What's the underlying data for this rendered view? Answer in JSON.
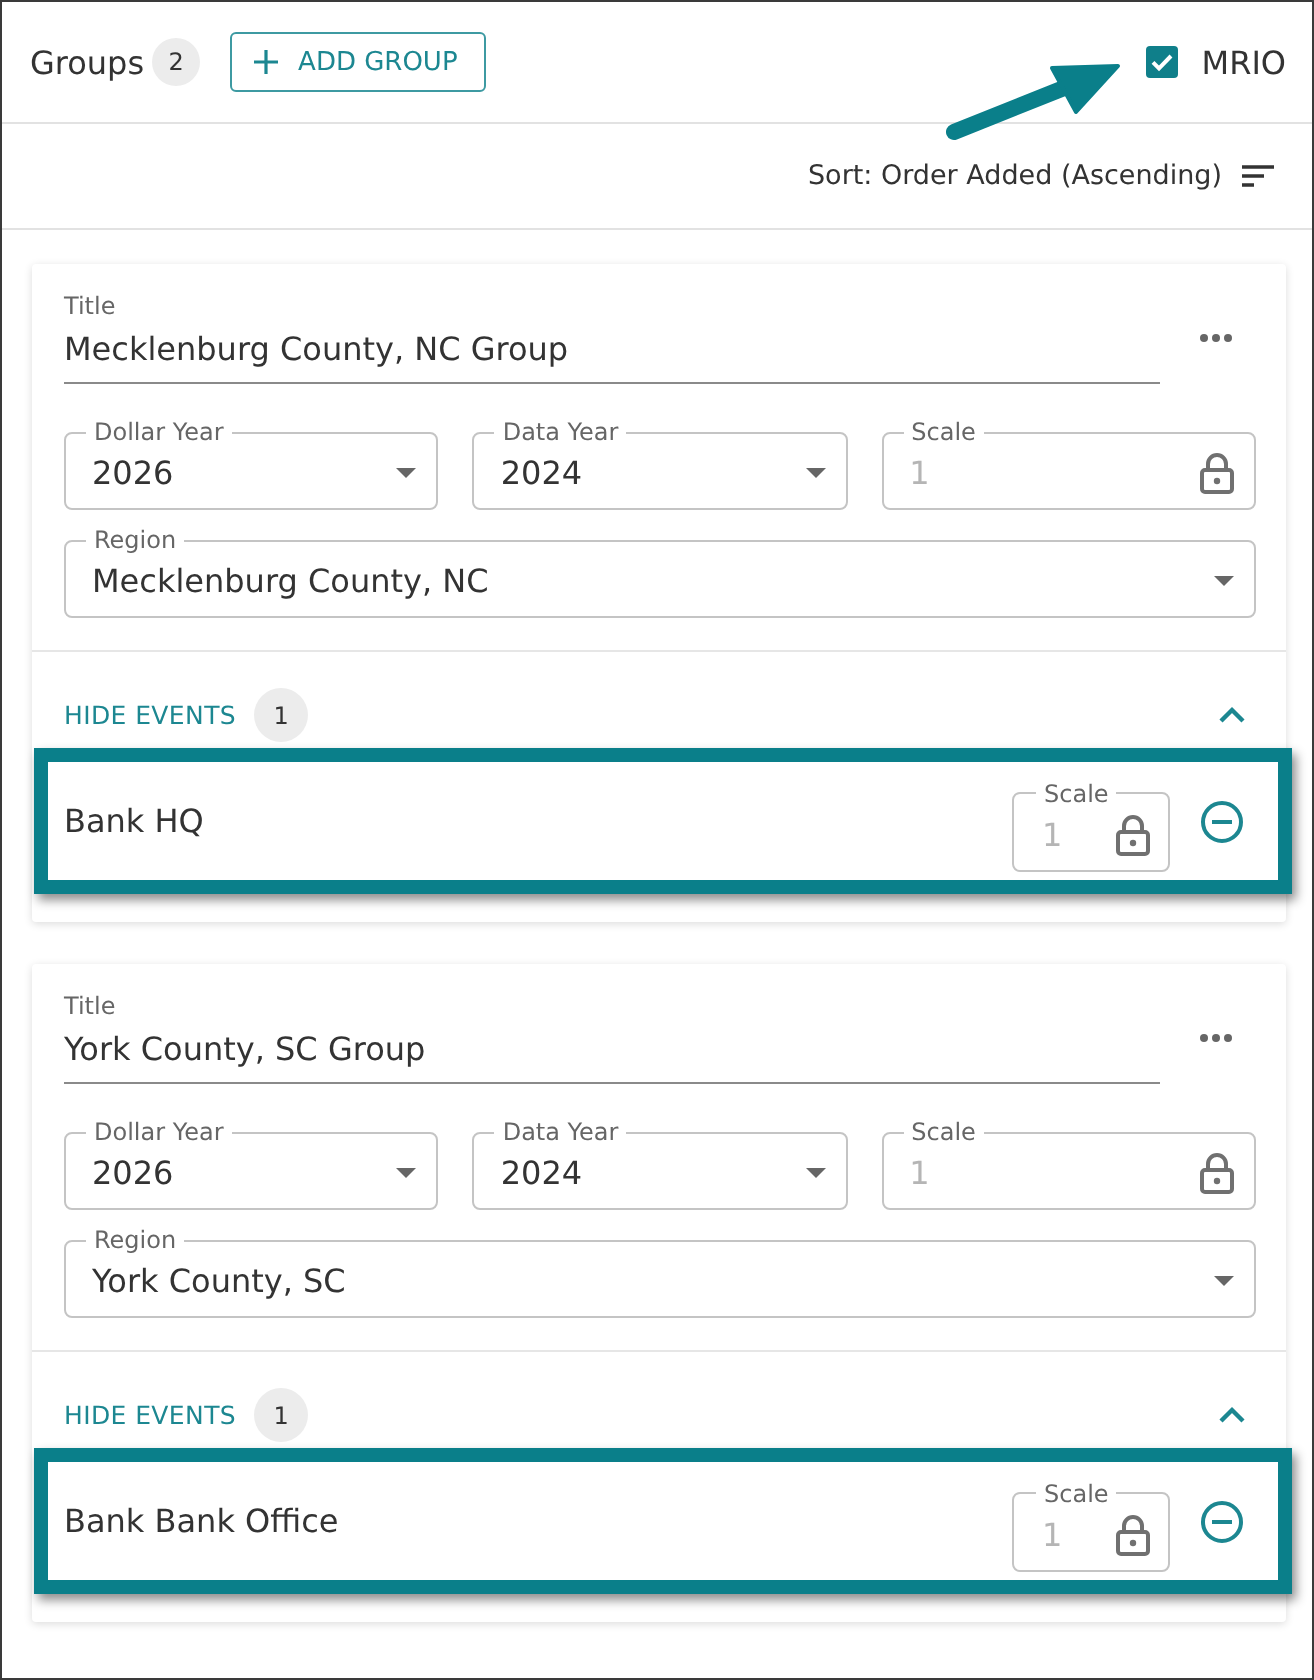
{
  "header": {
    "title": "Groups",
    "count": "2",
    "add_button": "ADD GROUP",
    "mrio": {
      "label": "MRIO",
      "checked": true,
      "arrow": true
    }
  },
  "sort": {
    "label": "Sort: Order Added (Ascending)"
  },
  "groups": [
    {
      "title_label": "Title",
      "title": "Mecklenburg County, NC Group",
      "fields": [
        {
          "kind": "select",
          "label": "Dollar Year",
          "value": "2026"
        },
        {
          "kind": "select",
          "label": "Data Year",
          "value": "2024"
        },
        {
          "kind": "locked",
          "label": "Scale",
          "value": "1"
        }
      ],
      "region": {
        "kind": "select",
        "label": "Region",
        "value": "Mecklenburg County, NC"
      },
      "events_toggle": {
        "label": "HIDE EVENTS",
        "count": "1",
        "expanded": true
      },
      "events": [
        {
          "name": "Bank HQ",
          "highlighted": true,
          "scale": {
            "kind": "locked",
            "label": "Scale",
            "value": "1"
          }
        }
      ]
    },
    {
      "title_label": "Title",
      "title": "York County, SC Group",
      "fields": [
        {
          "kind": "select",
          "label": "Dollar Year",
          "value": "2026"
        },
        {
          "kind": "select",
          "label": "Data Year",
          "value": "2024"
        },
        {
          "kind": "locked",
          "label": "Scale",
          "value": "1"
        }
      ],
      "region": {
        "kind": "select",
        "label": "Region",
        "value": "York County, SC"
      },
      "events_toggle": {
        "label": "HIDE EVENTS",
        "count": "1",
        "expanded": true
      },
      "events": [
        {
          "name": "Bank Bank Office",
          "highlighted": true,
          "scale": {
            "kind": "locked",
            "label": "Scale",
            "value": "1"
          }
        }
      ]
    }
  ]
}
